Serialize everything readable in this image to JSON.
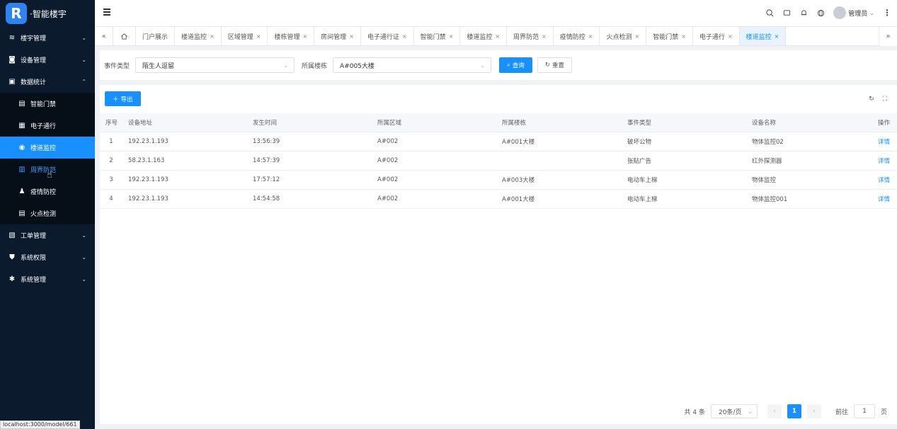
{
  "app": {
    "logo_letter": "R",
    "logo_text": "·智能楼宇"
  },
  "sidebar": {
    "items": [
      {
        "label": "楼宇管理",
        "icon": "layers-icon"
      },
      {
        "label": "设备管理",
        "icon": "device-icon"
      },
      {
        "label": "数据统计",
        "icon": "stats-icon"
      }
    ],
    "sub_items": [
      {
        "label": "智能门禁",
        "icon": "door-icon"
      },
      {
        "label": "电子通行",
        "icon": "pass-icon"
      },
      {
        "label": "楼道监控",
        "icon": "camera-icon"
      },
      {
        "label": "周界防范",
        "icon": "fence-icon"
      },
      {
        "label": "疫情防控",
        "icon": "user-icon"
      },
      {
        "label": "火点检测",
        "icon": "fire-icon"
      }
    ],
    "bottom_items": [
      {
        "label": "工单管理",
        "icon": "clipboard-icon"
      },
      {
        "label": "系统权限",
        "icon": "shield-icon"
      },
      {
        "label": "系统管理",
        "icon": "gear-icon"
      }
    ]
  },
  "header": {
    "user_name": "管理员"
  },
  "tabs": [
    {
      "label": "门户展示",
      "closable": false
    },
    {
      "label": "楼道监控",
      "closable": true
    },
    {
      "label": "区域管理",
      "closable": true
    },
    {
      "label": "楼栋管理",
      "closable": true
    },
    {
      "label": "房间管理",
      "closable": true
    },
    {
      "label": "电子通行证",
      "closable": true
    },
    {
      "label": "智能门禁",
      "closable": true
    },
    {
      "label": "楼道监控",
      "closable": true
    },
    {
      "label": "周界防范",
      "closable": true
    },
    {
      "label": "疫情防控",
      "closable": true
    },
    {
      "label": "火点检测",
      "closable": true
    },
    {
      "label": "智能门禁",
      "closable": true
    },
    {
      "label": "电子通行",
      "closable": true
    },
    {
      "label": "楼道监控",
      "closable": true
    }
  ],
  "search": {
    "event_type_label": "事件类型",
    "event_type_value": "陌生人逗留",
    "building_label": "所属楼栋",
    "building_value": "A#005大楼",
    "query_label": "查询",
    "reset_label": "重置"
  },
  "toolbar": {
    "export_label": "导出"
  },
  "table": {
    "columns": [
      "序号",
      "设备地址",
      "发生时间",
      "所属区域",
      "所属楼栋",
      "事件类型",
      "设备名称",
      "操作"
    ],
    "rows": [
      [
        "1",
        "192.23.1.193",
        "13:56:39",
        "A#002",
        "A#001大楼",
        "破坏公物",
        "物体监控02",
        "详情"
      ],
      [
        "2",
        "58.23.1.163",
        "14:57:39",
        "A#002",
        "",
        "张贴广告",
        "红外探测器",
        "详情"
      ],
      [
        "3",
        "192.23.1.193",
        "17:57:12",
        "A#002",
        "A#003大楼",
        "电动车上梯",
        "物体监控",
        "详情"
      ],
      [
        "4",
        "192.23.1.193",
        "14:54:58",
        "A#002",
        "A#001大楼",
        "电动车上梯",
        "物体监控001",
        "详情"
      ]
    ]
  },
  "pagination": {
    "total_text": "共 4 条",
    "page_size": "20条/页",
    "current_page": "1",
    "goto_label": "前往",
    "goto_value": "1",
    "page_unit": "页"
  },
  "status_url": "localhost:3000/model/661"
}
